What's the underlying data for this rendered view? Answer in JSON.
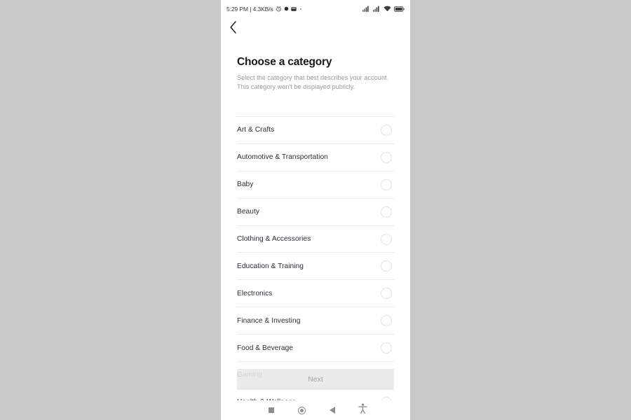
{
  "statusbar": {
    "clock": "5:29 PM | 4.3KB/s",
    "icons_left": [
      "alarm-icon",
      "record-dot-icon",
      "app-badge-icon",
      "small-dot-icon"
    ],
    "icons_right": [
      "signal-sim1-icon",
      "signal-sim2-icon",
      "wifi-icon",
      "battery-icon"
    ]
  },
  "header": {
    "back_icon": "chevron-left-icon",
    "title": "Choose a category",
    "subtitle": "Select the category that best describes your account. This category won't be displayed publicly."
  },
  "categories": [
    {
      "label": "Art & Crafts",
      "selected": false
    },
    {
      "label": "Automotive & Transportation",
      "selected": false
    },
    {
      "label": "Baby",
      "selected": false
    },
    {
      "label": "Beauty",
      "selected": false
    },
    {
      "label": "Clothing & Accessories",
      "selected": false
    },
    {
      "label": "Education & Training",
      "selected": false
    },
    {
      "label": "Electronics",
      "selected": false
    },
    {
      "label": "Finance & Investing",
      "selected": false
    },
    {
      "label": "Food & Beverage",
      "selected": false
    },
    {
      "label": "Gaming",
      "selected": false
    },
    {
      "label": "Health & Wellness",
      "selected": false
    }
  ],
  "next_button": {
    "label": "Next",
    "enabled": false
  },
  "navbar": {
    "items": [
      {
        "icon": "recents-square-icon"
      },
      {
        "icon": "home-circle-icon"
      },
      {
        "icon": "back-triangle-icon"
      },
      {
        "icon": "accessibility-icon"
      }
    ]
  },
  "colors": {
    "page_background": "#c9c9c9",
    "phone_background": "#ffffff",
    "title_text": "#16181c",
    "subtitle_text": "#9a9a9a",
    "list_text": "#2a2d33",
    "divider": "#ededed",
    "radio_outline": "#e2e2e2",
    "next_bg": "#e8e8e8",
    "next_text": "#a3a3a3",
    "nav_icon": "#8e8e8e"
  }
}
